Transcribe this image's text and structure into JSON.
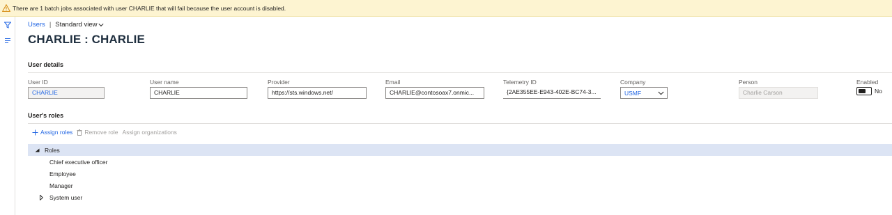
{
  "banner": {
    "message": "There are 1 batch jobs associated with user CHARLIE that will fail because the user account is disabled.",
    "icon": "warning-icon",
    "color": "#fdf4d1"
  },
  "leftrail": {
    "icons": [
      "filter-icon",
      "list-icon"
    ]
  },
  "breadcrumb": {
    "link": "Users",
    "separator": "|",
    "view": "Standard view"
  },
  "page_title": "CHARLIE : CHARLIE",
  "user_details": {
    "heading": "User details",
    "fields": {
      "user_id": {
        "label": "User ID",
        "value": "CHARLIE"
      },
      "user_name": {
        "label": "User name",
        "value": "CHARLIE"
      },
      "provider": {
        "label": "Provider",
        "value": "https://sts.windows.net/"
      },
      "email": {
        "label": "Email",
        "value": "CHARLIE@contosoax7.onmic..."
      },
      "telemetry": {
        "label": "Telemetry ID",
        "value": "{2AE355EE-E943-402E-BC74-3..."
      },
      "company": {
        "label": "Company",
        "value": "USMF"
      },
      "person": {
        "label": "Person",
        "value": "Charlie Carson"
      },
      "enabled": {
        "label": "Enabled",
        "value": "No"
      }
    }
  },
  "users_roles": {
    "heading": "User's roles",
    "actions": {
      "assign": "Assign roles",
      "remove": "Remove role",
      "assign_orgs": "Assign organizations"
    },
    "tree": {
      "root": "Roles",
      "children": [
        "Chief executive officer",
        "Employee",
        "Manager"
      ],
      "collapsed": "System user"
    }
  },
  "colors": {
    "accent": "#2266e3",
    "selected_row": "#dce4f4"
  }
}
